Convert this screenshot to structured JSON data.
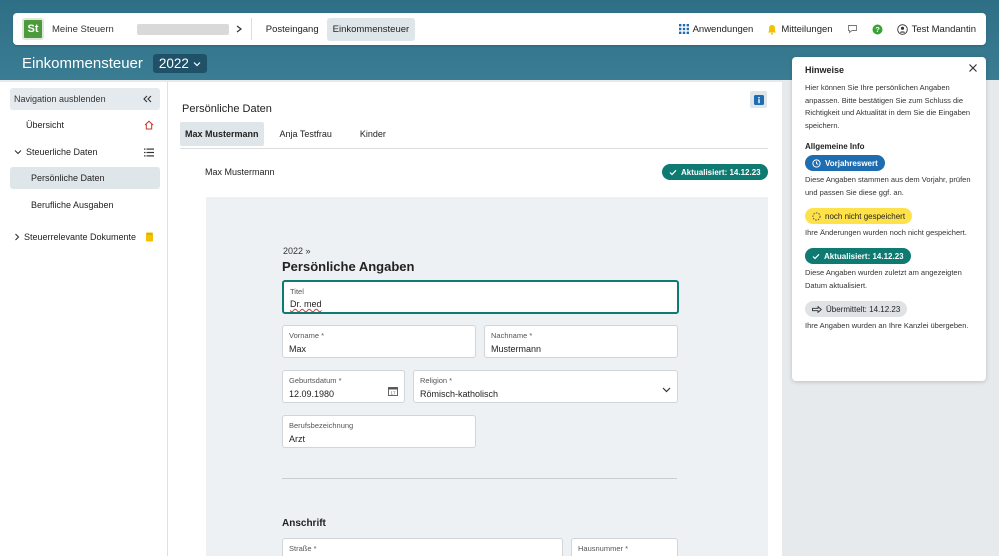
{
  "topnav": {
    "logo": "St",
    "brand": "Meine Steuern",
    "links": [
      "Posteingang",
      "Einkommensteuer"
    ],
    "apps": "Anwendungen",
    "messages": "Mitteilungen",
    "user": "Test Mandantin"
  },
  "page": {
    "title": "Einkommensteuer",
    "year": "2022"
  },
  "sidebar": {
    "hide_label": "Navigation ausblenden",
    "items": [
      {
        "label": "Übersicht"
      },
      {
        "label": "Steuerliche Daten"
      },
      {
        "label": "Persönliche Daten"
      },
      {
        "label": "Berufliche Ausgaben"
      },
      {
        "label": "Steuerrelevante Dokumente"
      }
    ]
  },
  "content": {
    "section_title": "Persönliche Daten",
    "tabs": [
      "Max Mustermann",
      "Anja Testfrau",
      "Kinder"
    ],
    "person_name": "Max Mustermann",
    "status_badge": "Aktualisiert: 14.12.23"
  },
  "form": {
    "crumb": "2022 »",
    "title": "Persönliche Angaben",
    "fields": {
      "titel": {
        "label": "Titel",
        "value": "Dr. med"
      },
      "vorname": {
        "label": "Vorname *",
        "value": "Max"
      },
      "nachname": {
        "label": "Nachname *",
        "value": "Mustermann"
      },
      "geburtsdatum": {
        "label": "Geburtsdatum *",
        "value": "12.09.1980"
      },
      "religion": {
        "label": "Religion *",
        "value": "Römisch-katholisch"
      },
      "beruf": {
        "label": "Berufsbezeichnung",
        "value": "Arzt"
      },
      "strasse": {
        "label": "Straße *"
      },
      "hausnummer": {
        "label": "Hausnummer *"
      }
    },
    "address_title": "Anschrift"
  },
  "hints": {
    "title": "Hinweise",
    "intro": "Hier können Sie Ihre persönlichen Angaben anpassen. Bitte bestätigen Sie zum Schluss die Richtigkeit und Aktualität in dem Sie die Eingaben speichern.",
    "general": "Allgemeine Info",
    "badges": {
      "prev": "Vorjahreswert",
      "unsaved": "noch nicht gespeichert",
      "updated": "Aktualisiert: 14.12.23",
      "sent": "Übermittelt: 14.12.23"
    },
    "texts": {
      "prev": "Diese Angaben stammen aus dem Vorjahr, prüfen und passen Sie diese ggf. an.",
      "unsaved": "Ihre Änderungen wurden noch nicht gespeichert.",
      "updated": "Diese Angaben wurden zuletzt am angezeigten Datum aktualisiert.",
      "sent": "Ihre Angaben wurden an Ihre Kanzlei übergeben."
    }
  },
  "colors": {
    "teal": "#0f7a72",
    "header": "#2f6f86",
    "blue": "#1f6db1",
    "yellow": "#ffe24a"
  }
}
